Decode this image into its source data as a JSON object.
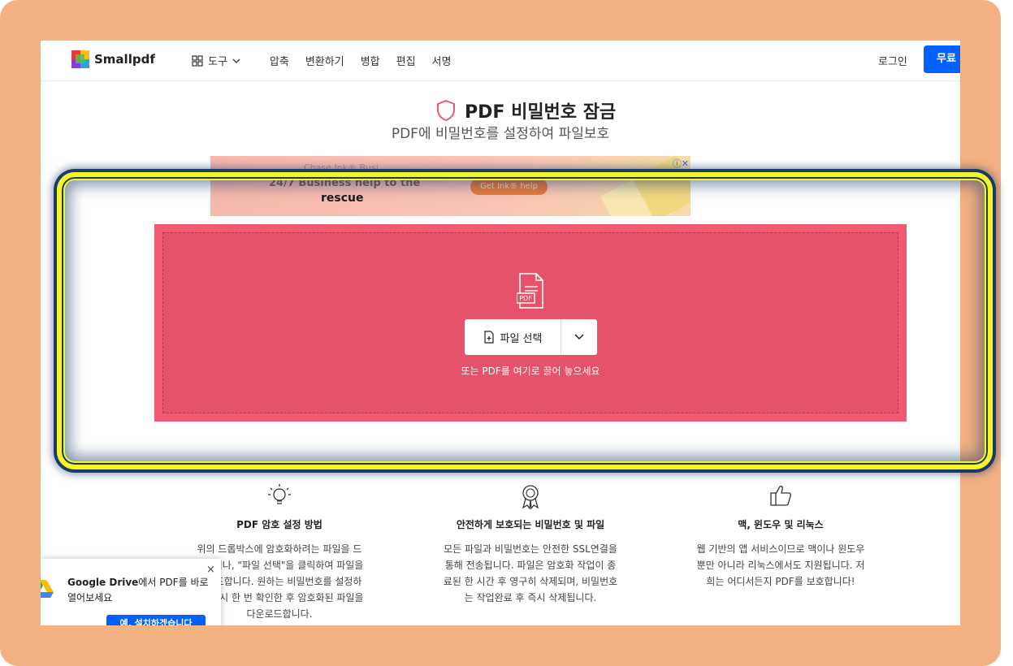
{
  "header": {
    "logo_text": "Smallpdf",
    "tools_label": "도구",
    "nav_items": [
      "압축",
      "변환하기",
      "병합",
      "편집",
      "서명"
    ],
    "login_label": "로그인",
    "free_button_label": "무료 체"
  },
  "hero": {
    "title": "PDF 비밀번호 잠금",
    "subtitle": "PDF에 비밀번호를 설정하여 파일보호"
  },
  "ad": {
    "line1": "Chase Ink® Busi",
    "line2": "24/7 Business help to the",
    "line3": "rescue",
    "button_label": "Get Ink® help",
    "close_glyphs": "ⓘ✕"
  },
  "dropzone": {
    "file_badge": "PDF",
    "choose_file_label": "파일 선택",
    "hint": "또는 PDF를 여기로 끌어 놓으세요",
    "color": "#e5526a"
  },
  "features": [
    {
      "icon": "lightbulb-icon",
      "title": "PDF 암호 설정 방법",
      "lines": [
        "위의 드롭박스에 암호화하려는 파일을 드",
        "롭하거나, \"파일 선택\"을 클릭하여 파일을",
        "업로드합니다. 원하는 비밀번호를 설정하",
        "고, 다시 한 번 확인한 후 암호화된 파일을",
        "다운로드합니다."
      ]
    },
    {
      "icon": "award-icon",
      "title": "안전하게 보호되는 비밀번호 및 파일",
      "lines": [
        "모든 파일과 비밀번호는 안전한 SSL연결을",
        "통해 전송됩니다. 파일은 암호화 작업이 종",
        "료된 한 시간 후 영구히 삭제되며, 비밀번호",
        "는 작업완료 후 즉시 삭제됩니다."
      ]
    },
    {
      "icon": "thumbs-up-icon",
      "title": "맥, 윈도우 및 리눅스",
      "lines": [
        "웹 기반의 앱 서비스이므로 맥이나 윈도우",
        "뿐만 아니라 리눅스에서도 지원됩니다. 저",
        "희는 어디서든지 PDF를 보호합니다!"
      ]
    }
  ],
  "popup": {
    "text_bold": "Google Drive",
    "text_rest": "에서 PDF를 바로 열어보세요",
    "button_label": "예, 설치하겠습니다",
    "close_glyph": "×"
  },
  "colors": {
    "frame": "#f4b182",
    "highlight": "#f6f423",
    "primary": "#0061fe"
  }
}
